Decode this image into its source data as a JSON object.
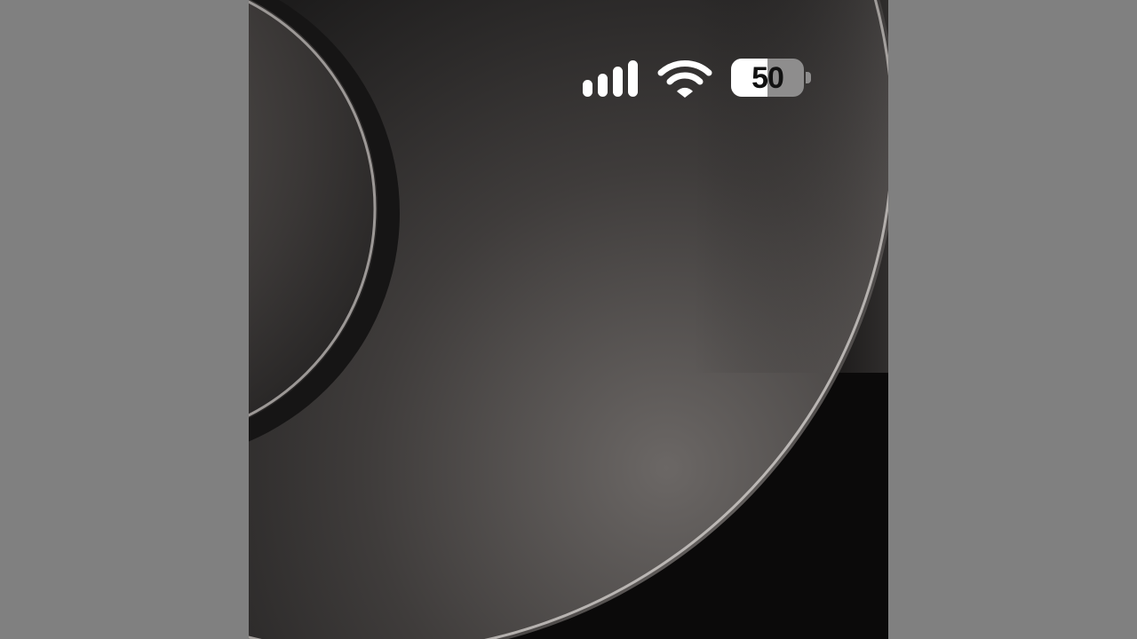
{
  "status_bar": {
    "signal": {
      "icon": "cellular-signal-icon",
      "bars_filled": 4,
      "bars_total": 4
    },
    "wifi": {
      "icon": "wifi-icon"
    },
    "battery": {
      "icon": "battery-icon",
      "level_text": "50",
      "level_percent": 50
    }
  },
  "wallpaper": {
    "icon": "abstract-curves-wallpaper",
    "colors": {
      "base": "#0b0a0a",
      "surface": "#151414",
      "highlight": "#6e6a68",
      "rim": "#bdb9b6"
    }
  }
}
